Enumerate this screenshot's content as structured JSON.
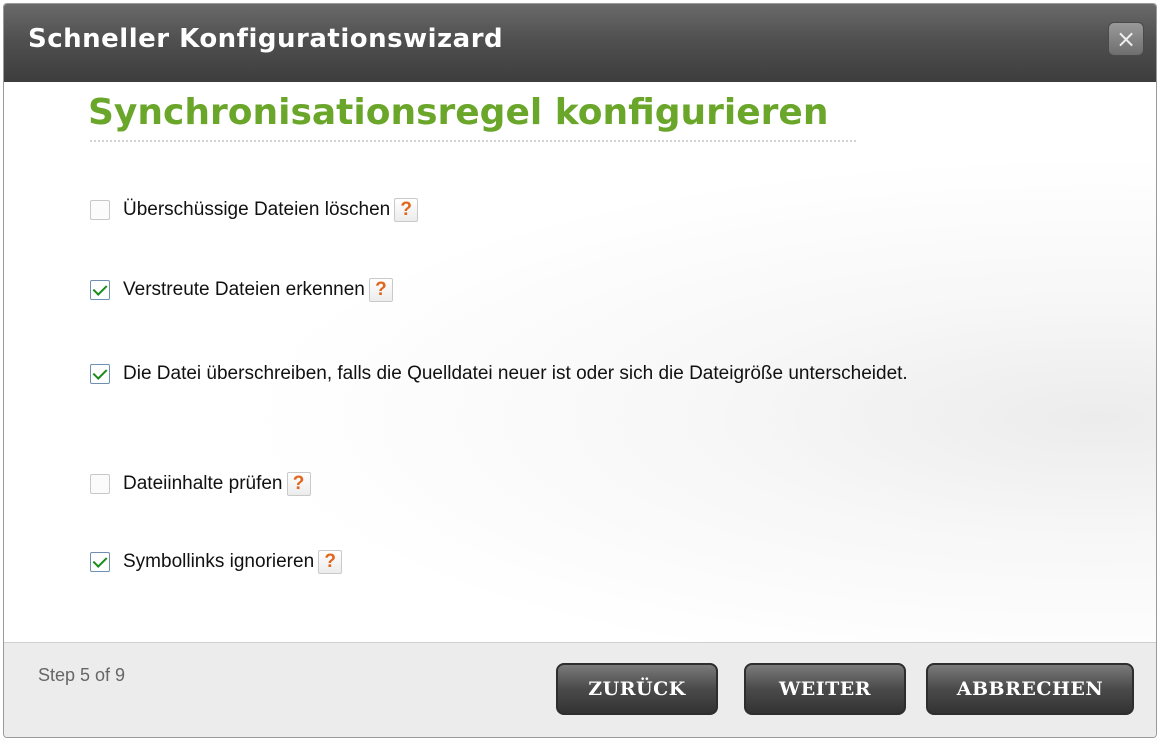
{
  "window": {
    "title": "Schneller Konfigurationswizard",
    "close_label": "×"
  },
  "content": {
    "heading": "Synchronisationsregel konfigurieren",
    "options": [
      {
        "label": "Überschüssige Dateien löschen",
        "checked": false,
        "has_help": true
      },
      {
        "label": "Verstreute Dateien erkennen",
        "checked": true,
        "has_help": true
      },
      {
        "label": "Die Datei überschreiben, falls die Quelldatei neuer ist oder sich die Dateigröße unterscheidet.",
        "checked": true,
        "has_help": false
      },
      {
        "label": "Dateiinhalte prüfen",
        "checked": false,
        "has_help": true
      },
      {
        "label": "Symbollinks ignorieren",
        "checked": true,
        "has_help": true
      }
    ],
    "help_glyph": "?"
  },
  "footer": {
    "step": "Step 5 of 9",
    "back_label": "ZURÜCK",
    "next_label": "WEITER",
    "cancel_label": "ABBRECHEN"
  },
  "colors": {
    "heading": "#6aa62a",
    "help_mark": "#e1661d",
    "titlebar": "#505050",
    "check": "#1a8a1a"
  }
}
